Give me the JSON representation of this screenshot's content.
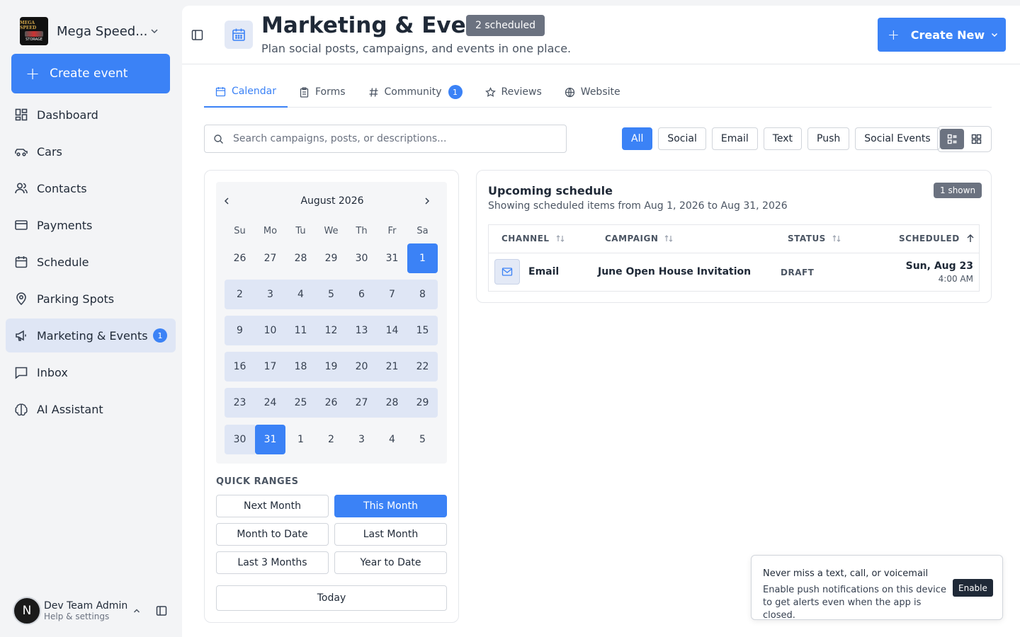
{
  "brand": {
    "name": "Mega Speed...",
    "logo_text_top": "MEGA SPEED",
    "logo_text_bottom": "STORAGE"
  },
  "sidebar": {
    "create_label": "Create event",
    "items": [
      {
        "label": "Dashboard",
        "icon": "dashboard-icon"
      },
      {
        "label": "Cars",
        "icon": "car-icon"
      },
      {
        "label": "Contacts",
        "icon": "users-icon"
      },
      {
        "label": "Payments",
        "icon": "credit-card-icon"
      },
      {
        "label": "Schedule",
        "icon": "calendar-icon"
      },
      {
        "label": "Parking Spots",
        "icon": "map-pin-icon"
      },
      {
        "label": "Marketing & Events",
        "icon": "megaphone-icon",
        "active": true,
        "badge": "1"
      },
      {
        "label": "Inbox",
        "icon": "message-square-icon"
      },
      {
        "label": "AI Assistant",
        "icon": "brain-icon"
      }
    ],
    "user": {
      "initial": "N",
      "name": "Dev Team Admin",
      "sub": "Help & settings"
    }
  },
  "header": {
    "title": "Marketing & Events",
    "badge": "2 scheduled",
    "subtitle": "Plan social posts, campaigns, and events in one place.",
    "create_new_label": "Create New"
  },
  "tabs": [
    {
      "label": "Calendar",
      "icon": "calendar-icon",
      "active": true
    },
    {
      "label": "Forms",
      "icon": "clipboard-icon"
    },
    {
      "label": "Community",
      "icon": "hash-icon",
      "badge": "1"
    },
    {
      "label": "Reviews",
      "icon": "star-icon"
    },
    {
      "label": "Website",
      "icon": "globe-icon"
    }
  ],
  "search": {
    "placeholder": "Search campaigns, posts, or descriptions..."
  },
  "filters": [
    "All",
    "Social",
    "Email",
    "Text",
    "Push",
    "Social Events"
  ],
  "active_filter": "All",
  "calendar": {
    "month_label": "August 2026",
    "weekdays": [
      "Su",
      "Mo",
      "Tu",
      "We",
      "Th",
      "Fr",
      "Sa"
    ],
    "weeks": [
      [
        "26",
        "27",
        "28",
        "29",
        "30",
        "31",
        "1"
      ],
      [
        "2",
        "3",
        "4",
        "5",
        "6",
        "7",
        "8"
      ],
      [
        "9",
        "10",
        "11",
        "12",
        "13",
        "14",
        "15"
      ],
      [
        "16",
        "17",
        "18",
        "19",
        "20",
        "21",
        "22"
      ],
      [
        "23",
        "24",
        "25",
        "26",
        "27",
        "28",
        "29"
      ],
      [
        "30",
        "31",
        "1",
        "2",
        "3",
        "4",
        "5"
      ]
    ],
    "range_start": "1",
    "range_end": "31"
  },
  "quick_ranges": {
    "label": "QUICK RANGES",
    "items": [
      "Next Month",
      "This Month",
      "Month to Date",
      "Last Month",
      "Last 3 Months",
      "Year to Date"
    ],
    "active": "This Month",
    "today_label": "Today"
  },
  "schedule": {
    "title": "Upcoming schedule",
    "subtitle": "Showing scheduled items from Aug 1, 2026 to Aug 31, 2026",
    "shown_badge": "1 shown",
    "columns": [
      "CHANNEL",
      "CAMPAIGN",
      "STATUS",
      "SCHEDULED"
    ],
    "rows": [
      {
        "channel": "Email",
        "campaign": "June Open House Invitation",
        "status": "DRAFT",
        "date": "Sun, Aug 23",
        "time": "4:00 AM"
      }
    ]
  },
  "toast": {
    "title": "Never miss a text, call, or voicemail",
    "body": "Enable push notifications on this device to get alerts even when the app is closed.",
    "button": "Enable"
  },
  "colors": {
    "accent": "#3b82f6",
    "range_bg": "#dfe6f5",
    "badge_gray": "#6b7280"
  }
}
